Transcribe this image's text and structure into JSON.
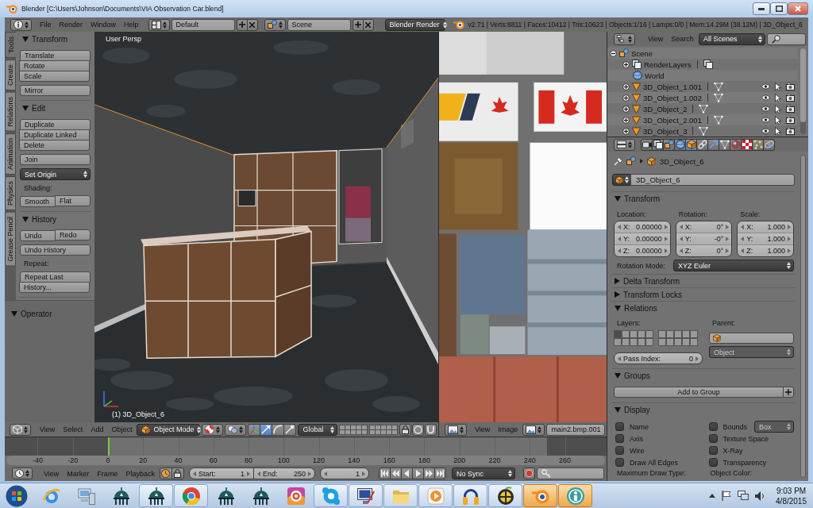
{
  "window": {
    "title": "Blender [C:\\Users\\Johnson\\Documents\\VIA Observation Car.blend]"
  },
  "info_header": {
    "menus": [
      "File",
      "Render",
      "Window",
      "Help"
    ],
    "screen_layout": "Default",
    "scene": "Scene",
    "render_engine": "Blender Render",
    "stats": "v2.71 | Verts:8811 | Faces:10412 | Tris:10623 | Objects:1/16 | Lamps:0/0 | Mem:14.29M (38.12M) | 3D_Object_6"
  },
  "tool_shelf": {
    "tabs": [
      {
        "label": "Tools",
        "selected": true
      },
      {
        "label": "Create",
        "selected": false
      },
      {
        "label": "Relations",
        "selected": false
      },
      {
        "label": "Animation",
        "selected": false
      },
      {
        "label": "Physics",
        "selected": false
      },
      {
        "label": "Grease Pencil",
        "selected": false
      }
    ],
    "panels": [
      {
        "title": "Transform",
        "expanded": true,
        "rows": [
          {
            "kind": "stack",
            "buttons": [
              "Translate",
              "Rotate",
              "Scale"
            ]
          },
          {
            "kind": "stack",
            "buttons": [
              "Mirror"
            ]
          }
        ]
      },
      {
        "title": "Edit",
        "expanded": true,
        "rows": [
          {
            "kind": "stack",
            "buttons": [
              "Duplicate",
              "Duplicate Linked",
              "Delete"
            ]
          },
          {
            "kind": "stack",
            "buttons": [
              "Join"
            ]
          },
          {
            "kind": "menu",
            "value": "Set Origin"
          },
          {
            "kind": "label",
            "text": "Shading:"
          },
          {
            "kind": "pair",
            "buttons": [
              "Smooth",
              "Flat"
            ]
          }
        ]
      },
      {
        "title": "History",
        "expanded": true,
        "rows": [
          {
            "kind": "pair",
            "buttons": [
              "Undo",
              "Redo"
            ]
          },
          {
            "kind": "stack",
            "buttons": [
              "Undo History"
            ]
          },
          {
            "kind": "label",
            "text": "Repeat:"
          },
          {
            "kind": "stack",
            "buttons": [
              "Repeat Last",
              "History..."
            ]
          }
        ]
      }
    ],
    "operator": {
      "title": "Operator",
      "expanded": true
    }
  },
  "viewport": {
    "view_name": "User Persp",
    "object_label": "(1) 3D_Object_6"
  },
  "view3d_header": {
    "menus": [
      "View",
      "Select",
      "Add",
      "Object"
    ],
    "mode": "Object Mode",
    "manipulators": [
      {
        "kind": "axes",
        "selected": false
      },
      {
        "kind": "translate",
        "selected": true
      },
      {
        "kind": "rotate",
        "selected": false
      },
      {
        "kind": "scale",
        "selected": false
      }
    ],
    "orientation": "Global"
  },
  "image_editor": {
    "menus": [
      "View",
      "Image"
    ],
    "image": "main2.bmp.001"
  },
  "timeline": {
    "ticks": [
      "-40",
      "-20",
      "0",
      "20",
      "40",
      "60",
      "80",
      "100",
      "120",
      "140",
      "160",
      "180",
      "200",
      "220",
      "240",
      "260"
    ],
    "menus": [
      "View",
      "Marker",
      "Frame",
      "Playback"
    ],
    "start": {
      "label": "Start:",
      "value": "1"
    },
    "end": {
      "label": "End:",
      "value": "250"
    },
    "current_frame": "1",
    "sync": "No Sync"
  },
  "outliner": {
    "menus": [
      "View",
      "Search"
    ],
    "filter": "All Scenes",
    "tree": [
      {
        "name": "Scene",
        "kind": "scene",
        "expanded": true,
        "children": [
          {
            "name": "RenderLayers",
            "kind": "render_layers",
            "expanded": false
          },
          {
            "name": "World",
            "kind": "world"
          },
          {
            "name": "3D_Object_1.001",
            "kind": "object",
            "expanded": false
          },
          {
            "name": "3D_Object_1.002",
            "kind": "object",
            "expanded": false
          },
          {
            "name": "3D_Object_2",
            "kind": "object",
            "expanded": false
          },
          {
            "name": "3D_Object_2.001",
            "kind": "object",
            "expanded": false
          },
          {
            "name": "3D_Object_3",
            "kind": "object",
            "expanded": false
          }
        ]
      }
    ]
  },
  "properties": {
    "tabs": [
      {
        "kind": "render",
        "selected": false
      },
      {
        "kind": "render_layers",
        "selected": false
      },
      {
        "kind": "scene",
        "selected": false
      },
      {
        "kind": "world",
        "selected": false
      },
      {
        "kind": "object",
        "selected": true
      },
      {
        "kind": "constraints",
        "selected": false
      },
      {
        "kind": "modifiers",
        "selected": false
      },
      {
        "kind": "data",
        "selected": false
      },
      {
        "kind": "material",
        "selected": false
      },
      {
        "kind": "texture",
        "selected": false
      },
      {
        "kind": "particles",
        "selected": false
      },
      {
        "kind": "physics",
        "selected": false
      }
    ],
    "breadcrumb": "3D_Object_6",
    "object_name": "3D_Object_6",
    "transform": {
      "title": "Transform",
      "expanded": true,
      "groups": [
        {
          "label": "Location:",
          "fields": [
            {
              "axis": "X:",
              "value": "0.00000"
            },
            {
              "axis": "Y:",
              "value": "0.00000"
            },
            {
              "axis": "Z:",
              "value": "0.00000"
            }
          ]
        },
        {
          "label": "Rotation:",
          "fields": [
            {
              "axis": "X:",
              "value": "0°"
            },
            {
              "axis": "Y:",
              "value": "-0°"
            },
            {
              "axis": "Z:",
              "value": "0°"
            }
          ]
        },
        {
          "label": "Scale:",
          "fields": [
            {
              "axis": "X:",
              "value": "1.000"
            },
            {
              "axis": "Y:",
              "value": "1.000"
            },
            {
              "axis": "Z:",
              "value": "1.000"
            }
          ]
        }
      ],
      "rotation_mode": {
        "label": "Rotation Mode:",
        "value": "XYZ Euler"
      }
    },
    "delta_transform": {
      "title": "Delta Transform",
      "expanded": false
    },
    "transform_locks": {
      "title": "Transform Locks",
      "expanded": false
    },
    "relations": {
      "title": "Relations",
      "expanded": true,
      "layers_label": "Layers:",
      "layers": [
        {
          "on": true
        },
        {
          "on": false
        },
        {
          "on": false
        },
        {
          "on": false
        },
        {
          "on": false
        },
        {
          "on": false
        },
        {
          "on": false
        },
        {
          "on": false
        },
        {
          "on": false
        },
        {
          "on": false
        },
        {
          "on": false
        },
        {
          "on": false
        },
        {
          "on": false
        },
        {
          "on": false
        },
        {
          "on": false
        },
        {
          "on": false
        },
        {
          "on": false
        },
        {
          "on": false
        },
        {
          "on": false
        },
        {
          "on": false
        }
      ],
      "parent_label": "Parent:",
      "parent_type": {
        "value": "Object",
        "disabled": true
      },
      "pass_index": {
        "label": "Pass Index:",
        "value": "0"
      }
    },
    "groups": {
      "title": "Groups",
      "expanded": true,
      "add_button": "Add to Group"
    },
    "display": {
      "title": "Display",
      "expanded": true,
      "options": [
        {
          "label": "Name",
          "checked": false
        },
        {
          "label": "Bounds",
          "checked": false,
          "menu": {
            "value": "Box",
            "disabled": true
          }
        },
        {
          "label": "Axis",
          "checked": false
        },
        {
          "label": "Texture Space",
          "checked": false
        },
        {
          "label": "Wire",
          "checked": false
        },
        {
          "label": "X-Ray",
          "checked": false
        },
        {
          "label": "Draw All Edges",
          "checked": false
        },
        {
          "label": "Transparency",
          "checked": false
        }
      ],
      "footer": [
        "Maximum Draw Type:",
        "Object Color:"
      ]
    }
  },
  "taskbar": {
    "apps": [
      {
        "kind": "browser",
        "open": false,
        "highlighted": false
      },
      {
        "kind": "computer",
        "open": false,
        "highlighted": false
      },
      {
        "kind": "dome",
        "open": false,
        "highlighted": false
      },
      {
        "kind": "dome",
        "open": true,
        "highlighted": false
      },
      {
        "kind": "wheel",
        "open": true,
        "highlighted": false
      },
      {
        "kind": "dome",
        "open": false,
        "highlighted": false
      },
      {
        "kind": "dome",
        "open": false,
        "highlighted": false
      },
      {
        "kind": "target",
        "open": false,
        "highlighted": false
      },
      {
        "kind": "chat",
        "open": true,
        "highlighted": false
      },
      {
        "kind": "easel",
        "open": true,
        "highlighted": false
      },
      {
        "kind": "folder",
        "open": true,
        "highlighted": false
      },
      {
        "kind": "player",
        "open": true,
        "highlighted": false
      },
      {
        "kind": "headphones",
        "open": true,
        "highlighted": false
      },
      {
        "kind": "fruit",
        "open": true,
        "highlighted": false
      },
      {
        "kind": "ring",
        "open": true,
        "highlighted": true
      },
      {
        "kind": "figure",
        "open": true,
        "highlighted": true
      }
    ],
    "clock": {
      "time": "9:03 PM",
      "date": "4/8/2015"
    }
  }
}
